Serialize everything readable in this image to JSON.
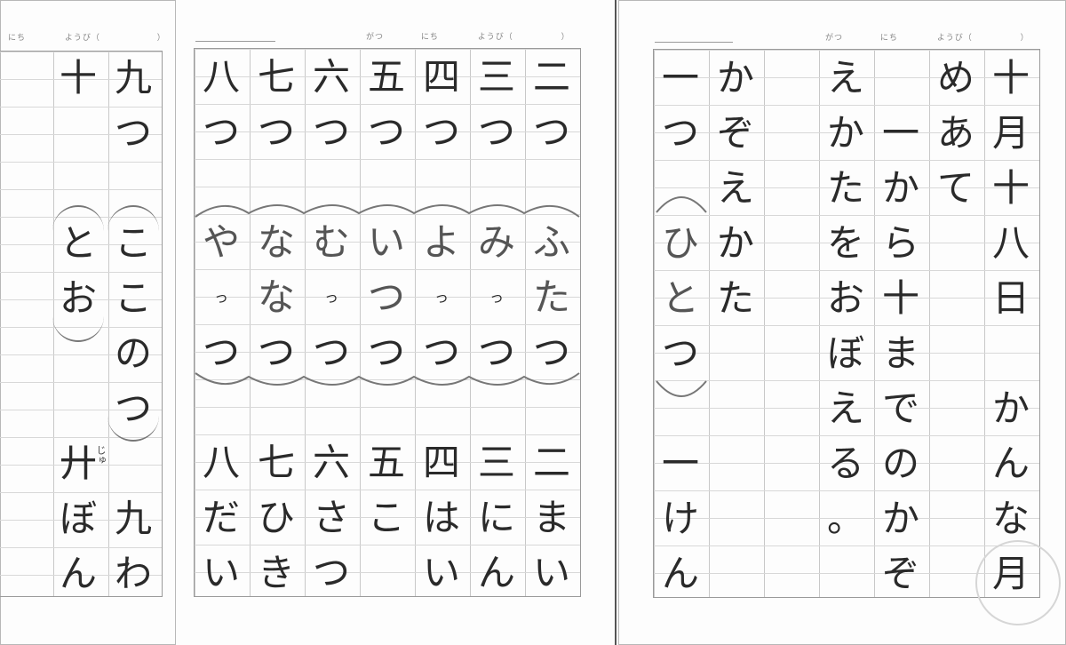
{
  "headers": {
    "left": {
      "nichi": "にち",
      "youbi": "ようび（",
      "close": "）"
    },
    "middle": {
      "gatsu": "がつ",
      "nichi": "にち",
      "youbi": "ようび（",
      "close": "）"
    },
    "right": {
      "gatsu": "がつ",
      "nichi": "にち",
      "youbi": "ようび（",
      "close": "）"
    }
  },
  "left_page": {
    "columns": [
      [
        "九",
        "つ",
        "",
        "こ",
        "こ",
        "の",
        "つ",
        "",
        "九",
        "わ"
      ],
      [
        "十",
        "",
        "",
        "と",
        "お",
        "",
        "",
        "廾",
        "ぼ",
        "ん"
      ]
    ],
    "ruby": "じゅ"
  },
  "middle_page": {
    "columns": [
      [
        "二",
        "つ",
        "",
        "ふ",
        "た",
        "つ",
        "",
        "二",
        "ま",
        "い"
      ],
      [
        "三",
        "つ",
        "",
        "み",
        "っ",
        "つ",
        "",
        "三",
        "に",
        "ん"
      ],
      [
        "四",
        "つ",
        "",
        "よ",
        "っ",
        "つ",
        "",
        "四",
        "は",
        "い"
      ],
      [
        "五",
        "つ",
        "",
        "い",
        "つ",
        "つ",
        "",
        "五",
        "こ",
        ""
      ],
      [
        "六",
        "つ",
        "",
        "む",
        "っ",
        "つ",
        "",
        "六",
        "さ",
        "つ"
      ],
      [
        "七",
        "つ",
        "",
        "な",
        "な",
        "つ",
        "",
        "七",
        "ひ",
        "き"
      ],
      [
        "八",
        "つ",
        "",
        "や",
        "っ",
        "つ",
        "",
        "八",
        "だ",
        "い"
      ]
    ]
  },
  "right_page": {
    "columns": [
      [
        "十",
        "月",
        "十",
        "八",
        "日",
        "",
        "か",
        "ん",
        "な",
        "月"
      ],
      [
        "め",
        "あ",
        "て",
        "",
        "",
        "",
        "",
        "",
        "",
        ""
      ],
      [
        "",
        "一",
        "か",
        "ら",
        "十",
        "ま",
        "で",
        "の",
        "か",
        "ぞ"
      ],
      [
        "え",
        "か",
        "た",
        "を",
        "お",
        "ぼ",
        "え",
        "る",
        "。",
        ""
      ],
      [
        "",
        "",
        "",
        "",
        "",
        "",
        "",
        "",
        "",
        ""
      ],
      [
        "か",
        "ぞ",
        "え",
        "か",
        "た",
        "",
        "",
        "",
        "",
        ""
      ],
      [
        "一",
        "つ",
        "",
        "ひ",
        "と",
        "つ",
        "",
        "一",
        "け",
        "ん"
      ]
    ]
  }
}
